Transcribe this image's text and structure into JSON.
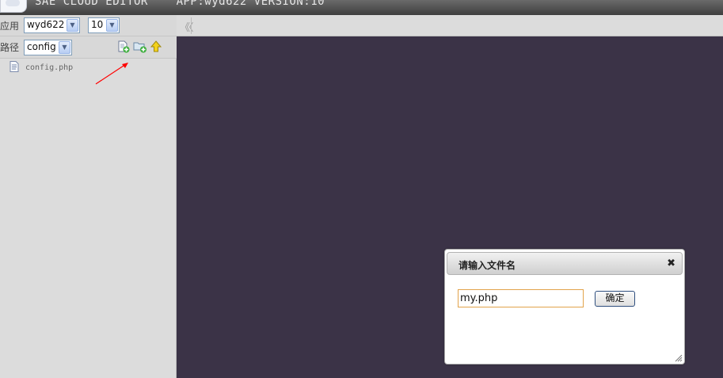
{
  "window": {
    "title": "SAE CLOUD EDITOR    APP:wyd622 VERSION:10"
  },
  "sidebar": {
    "app_label": "应用",
    "app_select": "wyd622",
    "version_select": "10",
    "path_label": "路径",
    "path_select": "config",
    "toolbar": [
      {
        "name": "new-file",
        "icon": "file-add-icon"
      },
      {
        "name": "new-folder",
        "icon": "folder-add-icon"
      },
      {
        "name": "go-up",
        "icon": "arrow-up-icon"
      }
    ],
    "files": [
      {
        "name": "config.php",
        "icon": "php-file-icon"
      }
    ]
  },
  "editor": {
    "collapse_glyph": "《〈",
    "background": "#3b3347"
  },
  "dialog": {
    "title": "请输入文件名",
    "input_value": "my.php",
    "ok_label": "确定",
    "close_glyph": "✖",
    "accent": "#e2a34b"
  },
  "annotation": {
    "arrow_color": "#ff0000"
  }
}
